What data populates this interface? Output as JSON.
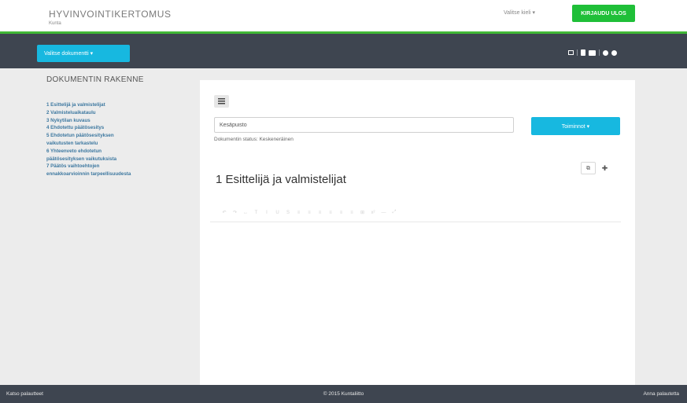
{
  "header": {
    "title": "HYVINVOINTIKERTOMUS",
    "subtitle": "Kunta",
    "language": "Valitse kieli ▾",
    "logout": "KIRJAUDU ULOS"
  },
  "navbar": {
    "doc_select": "Valitse dokumentti ▾"
  },
  "sidebar": {
    "title": "DOKUMENTIN RAKENNE",
    "items": [
      {
        "label": "1 Esittelijä ja valmistelijat"
      },
      {
        "label": "2 Valmisteluaikataulu"
      },
      {
        "label": "3 Nykytilan kuvaus"
      },
      {
        "label": "4 Ehdotettu päätösesitys"
      },
      {
        "label": "5 Ehdotetun päätösesityksen"
      },
      {
        "label": "vaikutusten tarkastelu"
      },
      {
        "label": "6 Yhteenveto ehdotetun"
      },
      {
        "label": "päätösesityksen vaikutuksista"
      },
      {
        "label": "7 Päätös vaihtoehtojen"
      },
      {
        "label": "ennakkoarvioinnin tarpeellisuudesta"
      }
    ]
  },
  "document": {
    "name_value": "Kesäpuisto",
    "status": "Dokumentin status: Keskeneräinen",
    "actions_label": "Toiminnot ▾",
    "section_title": "1 Esittelijä ja valmistelijat"
  },
  "editor_toolbar": [
    "↶",
    "↷",
    "↔",
    "T",
    "I",
    "U",
    "S",
    "≡",
    "≡",
    "≡",
    "≡",
    "≡",
    "≡",
    "⊞",
    "x²",
    "—",
    "⤢"
  ],
  "footer": {
    "left": "Katso palautteet",
    "center": "© 2015 Kuntaliitto",
    "right": "Anna palautetta"
  }
}
